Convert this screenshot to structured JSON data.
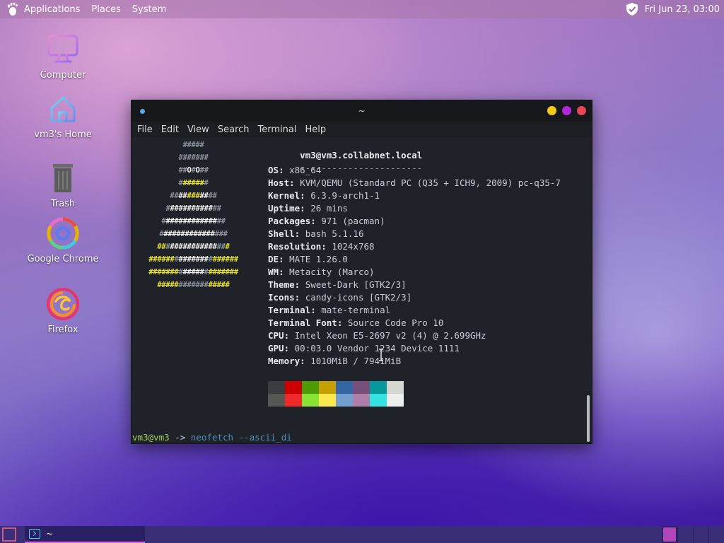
{
  "top_panel": {
    "menus": [
      "Applications",
      "Places",
      "System"
    ],
    "clock": "Fri Jun 23, 03:00"
  },
  "desktop_icons": [
    {
      "label": "Computer",
      "icon": "computer-icon"
    },
    {
      "label": "vm3's Home",
      "icon": "home-folder-icon"
    },
    {
      "label": "Trash",
      "icon": "trash-icon"
    },
    {
      "label": "Google Chrome",
      "icon": "chrome-icon"
    },
    {
      "label": "Firefox",
      "icon": "firefox-icon"
    }
  ],
  "terminal": {
    "title": "~",
    "menu": [
      "File",
      "Edit",
      "View",
      "Search",
      "Terminal",
      "Help"
    ],
    "header": "vm3@vm3.collabnet.local",
    "separator": "-----------------------",
    "info": [
      {
        "key": "OS",
        "value": "x86_64"
      },
      {
        "key": "Host",
        "value": "KVM/QEMU (Standard PC (Q35 + ICH9, 2009) pc-q35-7"
      },
      {
        "key": "Kernel",
        "value": "6.3.9-arch1-1"
      },
      {
        "key": "Uptime",
        "value": "26 mins"
      },
      {
        "key": "Packages",
        "value": "971 (pacman)"
      },
      {
        "key": "Shell",
        "value": "bash 5.1.16"
      },
      {
        "key": "Resolution",
        "value": "1024x768"
      },
      {
        "key": "DE",
        "value": "MATE 1.26.0"
      },
      {
        "key": "WM",
        "value": "Metacity (Marco)"
      },
      {
        "key": "Theme",
        "value": "Sweet-Dark [GTK2/3]"
      },
      {
        "key": "Icons",
        "value": "candy-icons [GTK2/3]"
      },
      {
        "key": "Terminal",
        "value": "mate-terminal"
      },
      {
        "key": "Terminal Font",
        "value": "Source Code Pro 10"
      },
      {
        "key": "CPU",
        "value": "Intel Xeon E5-2697 v2 (4) @ 2.699GHz"
      },
      {
        "key": "GPU",
        "value": "00:03.0 Vendor 1234 Device 1111"
      },
      {
        "key": "Memory",
        "value": "1010MiB / 7941MiB"
      }
    ],
    "color_blocks": {
      "row1": [
        "#3a3c40",
        "#cc0000",
        "#4e9a06",
        "#c4a000",
        "#3465a4",
        "#75507b",
        "#06989a",
        "#d3d7cf"
      ],
      "row2": [
        "#555753",
        "#ef2929",
        "#8ae234",
        "#fce94f",
        "#729fcf",
        "#ad7fa8",
        "#34e2e2",
        "#eeeeec"
      ]
    },
    "prompt": {
      "user": "vm3@vm3",
      "arrow": " -> ",
      "command": "neofetch --ascii_di"
    }
  },
  "taskbar": {
    "task_label": "~"
  },
  "colors": {
    "window_close": "#e64553",
    "window_maximize": "#b326d9",
    "window_minimize": "#f2c914"
  }
}
